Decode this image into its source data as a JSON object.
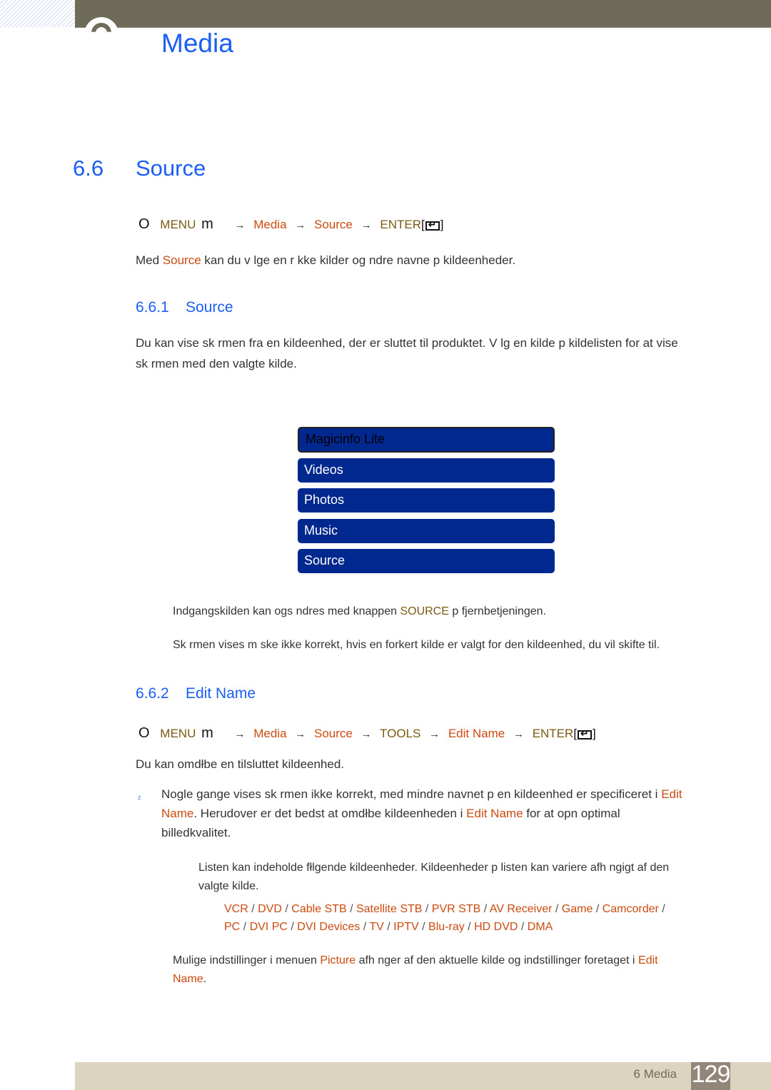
{
  "header": {
    "chapter_title": "Media",
    "chapter_number_icon": "chapter-circle-icon"
  },
  "section": {
    "number": "6.6",
    "title": "Source",
    "menu_path": {
      "lead_icon": "O",
      "menu": "MENU",
      "menu_icon": "m",
      "items": [
        "Media",
        "Source"
      ],
      "enter": "ENTER",
      "bracket_open": "[",
      "bracket_close": "]"
    },
    "intro": {
      "before": "Med ",
      "link": "Source",
      "after": " kan du v lge en r kke kilder og  ndre navne p  kildeenheder."
    }
  },
  "sub1": {
    "number": "6.6.1",
    "title": "Source",
    "para_line1": "Du kan vise sk rmen fra en kildeenhed, der er sluttet til produktet. V lg en kilde p  kildelisten for at vise",
    "para_line2": "sk rmen med den valgte kilde.",
    "source_list": [
      "Magicinfo Lite",
      "Videos",
      "Photos",
      "Music",
      "Source"
    ],
    "selected_index": 0,
    "note1": {
      "before": "Indgangskilden kan ogs   ndres med knappen ",
      "key": "SOURCE",
      "after": " p  fjernbetjeningen."
    },
    "note2": "Sk rmen vises m ske ikke korrekt, hvis en forkert kilde er valgt for den kildeenhed, du vil skifte til."
  },
  "sub2": {
    "number": "6.6.2",
    "title": "Edit Name",
    "menu_path": {
      "lead_icon": "O",
      "menu": "MENU",
      "menu_icon": "m",
      "items": [
        "Media",
        "Source"
      ],
      "tools": "TOOLS",
      "edit": "Edit Name",
      "enter": "ENTER",
      "bracket_open": "[",
      "bracket_close": "]"
    },
    "intro": "Du kan omdłbe en tilsluttet kildeenhed.",
    "bullet_marker": "z",
    "bullet": {
      "l1_before": "Nogle gange vises sk rmen ikke korrekt, med mindre navnet p  en kildeenhed er specificeret i ",
      "l1_link": "Edit",
      "l2_link": "Name",
      "l2_mid": ". Herudover er det bedst at omdłbe kildeenheden i ",
      "l2_link2": "Edit Name",
      "l2_after": "  for at opn  optimal",
      "l3": "billedkvalitet."
    },
    "list_note_l1": "Listen kan indeholde fłlgende kildeenheder. Kildeenheder p  listen kan variere afh ngigt af den",
    "list_note_l2": "valgte kilde.",
    "devices_row1": [
      "VCR",
      "DVD",
      "Cable STB",
      "Satellite STB",
      "PVR STB",
      "AV Receiver",
      "Game",
      "Camcorder"
    ],
    "devices_row2": [
      "PC",
      "DVI PC",
      "DVI Devices",
      "TV",
      "IPTV",
      "Blu-ray",
      "HD DVD",
      "DMA"
    ],
    "separator": "/",
    "final_note": {
      "before": "Mulige indstillinger i menuen ",
      "link": "Picture",
      "mid": " afh nger af den aktuelle kilde og indstillinger foretaget i ",
      "link2a": "Edit",
      "link2b": "Name",
      "after": "."
    }
  },
  "footer": {
    "label": "6 Media",
    "page": "129"
  }
}
